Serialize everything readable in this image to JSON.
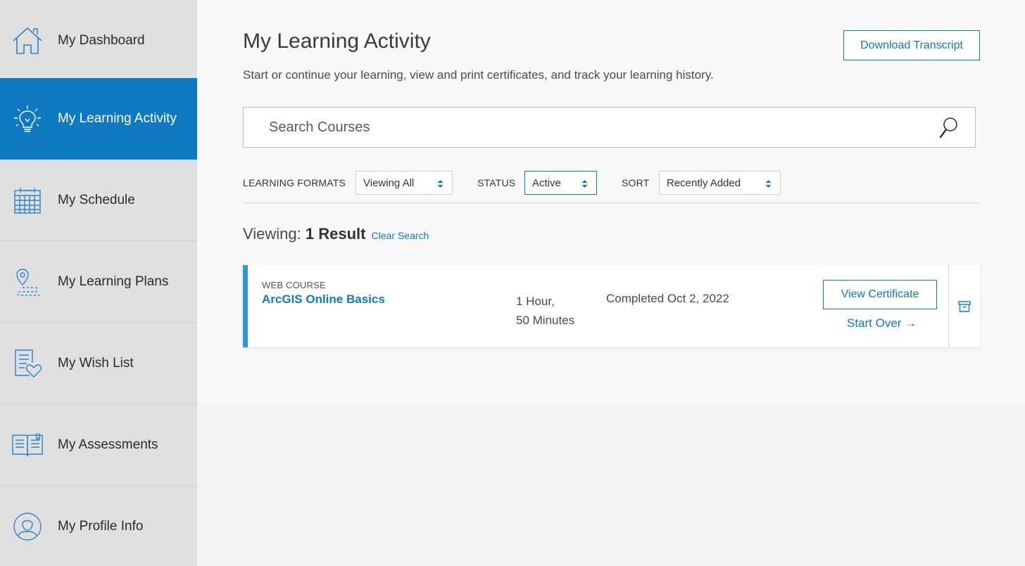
{
  "sidebar": {
    "items": [
      {
        "label": "My Dashboard",
        "icon": "home-icon",
        "active": false
      },
      {
        "label": "My Learning Activity",
        "icon": "lightbulb-icon",
        "active": true
      },
      {
        "label": "My Schedule",
        "icon": "calendar-icon",
        "active": false
      },
      {
        "label": "My Learning Plans",
        "icon": "map-pin-path-icon",
        "active": false
      },
      {
        "label": "My Wish List",
        "icon": "document-heart-icon",
        "active": false
      },
      {
        "label": "My Assessments",
        "icon": "open-book-icon",
        "active": false
      },
      {
        "label": "My Profile Info",
        "icon": "user-profile-icon",
        "active": false
      }
    ]
  },
  "header": {
    "title": "My Learning Activity",
    "subtitle": "Start or continue your learning, view and print certificates, and track your learning history.",
    "download_label": "Download Transcript"
  },
  "search": {
    "placeholder": "Search Courses",
    "value": ""
  },
  "filters": {
    "formats_label": "LEARNING FORMATS",
    "formats_value": "Viewing All",
    "status_label": "STATUS",
    "status_value": "Active",
    "sort_label": "SORT",
    "sort_value": "Recently Added"
  },
  "results": {
    "viewing_label": "Viewing:",
    "count_text": "1 Result",
    "clear_label": "Clear Search"
  },
  "courses": [
    {
      "type": "WEB COURSE",
      "title": "ArcGIS Online Basics",
      "duration_line1": "1 Hour,",
      "duration_line2": "50 Minutes",
      "status": "Completed Oct 2, 2022",
      "certificate_label": "View Certificate",
      "start_over_label": "Start Over →"
    }
  ],
  "colors": {
    "accent": "#0f79c2",
    "card_accent": "#2a9ad8",
    "sidebar_bg": "#e0e0e0",
    "page_bg": "#f8f8f8"
  }
}
